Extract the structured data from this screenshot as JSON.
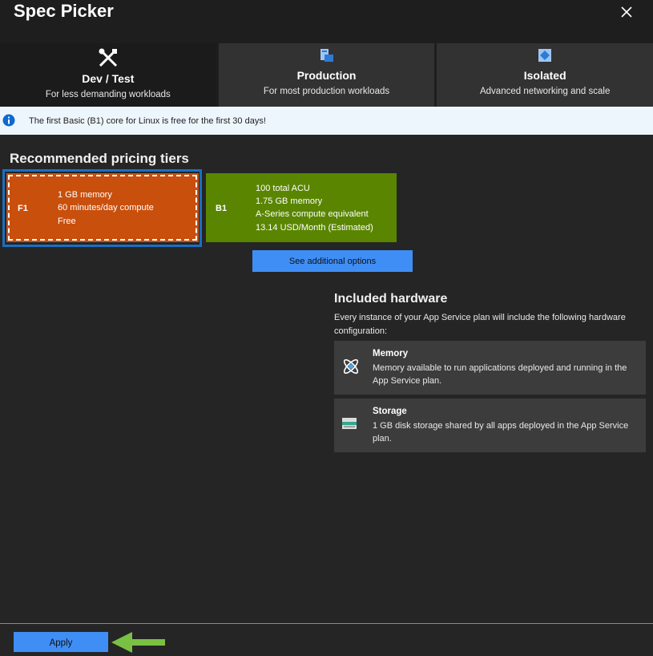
{
  "window": {
    "title": "Spec Picker"
  },
  "tabs": [
    {
      "name": "Dev / Test",
      "desc": "For less demanding workloads",
      "icon": "tools-icon",
      "active": true
    },
    {
      "name": "Production",
      "desc": "For most production workloads",
      "icon": "production-icon",
      "active": false
    },
    {
      "name": "Isolated",
      "desc": "Advanced networking and scale",
      "icon": "isolated-icon",
      "active": false
    }
  ],
  "info_bar": {
    "text": "The first Basic (B1) core for Linux is free for the first 30 days!",
    "icon": "info-icon"
  },
  "recommended": {
    "title": "Recommended pricing tiers",
    "tiers": [
      {
        "code": "F1",
        "lines": [
          "1 GB memory",
          "60 minutes/day compute",
          "Free"
        ],
        "color": "#c94f0c",
        "selected": true
      },
      {
        "code": "B1",
        "lines": [
          "100 total ACU",
          "1.75 GB memory",
          "A-Series compute equivalent",
          "13.14 USD/Month (Estimated)"
        ],
        "color": "#5a8500",
        "selected": false
      }
    ],
    "more_label": "See additional options"
  },
  "hardware": {
    "title": "Included hardware",
    "desc": "Every instance of your App Service plan will include the following hardware configuration:",
    "items": [
      {
        "name": "Memory",
        "text": "Memory available to run applications deployed and running in the App Service plan.",
        "icon": "memory-icon"
      },
      {
        "name": "Storage",
        "text": "1 GB disk storage shared by all apps deployed in the App Service plan.",
        "icon": "storage-icon"
      }
    ]
  },
  "footer": {
    "apply_label": "Apply"
  },
  "colors": {
    "accent": "#3f8ef5",
    "selection": "#1a6fc2",
    "arrow": "#7ac143"
  }
}
